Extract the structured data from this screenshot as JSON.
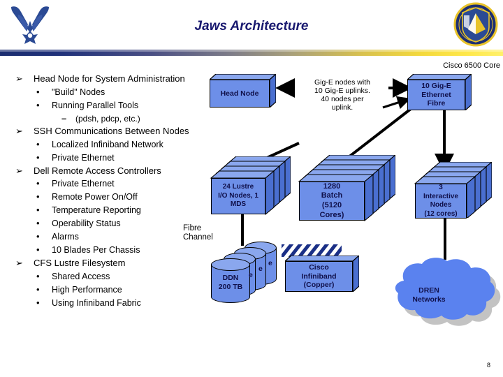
{
  "slide": {
    "title": "Jaws Architecture",
    "page_number": "8",
    "logos": {
      "left": "us-air-force-wings-logo",
      "right": "air-force-unit-shield-emblem"
    },
    "divider_colors": {
      "start": "#1b2d70",
      "middle": "#8c8a82",
      "end": "#ffe84a"
    },
    "title_color": "#1a1a70"
  },
  "bullets": [
    {
      "level": 1,
      "marker": "➢",
      "text": "Head Node for System Administration"
    },
    {
      "level": 2,
      "marker": "•",
      "text": "\"Build\" Nodes"
    },
    {
      "level": 2,
      "marker": "•",
      "text": "Running Parallel Tools"
    },
    {
      "level": 3,
      "marker": "–",
      "text": "(pdsh, pdcp, etc.)"
    },
    {
      "level": 1,
      "marker": "➢",
      "text": "SSH Communications Between Nodes"
    },
    {
      "level": 2,
      "marker": "•",
      "text": "Localized Infiniband Network"
    },
    {
      "level": 2,
      "marker": "•",
      "text": "Private Ethernet"
    },
    {
      "level": 1,
      "marker": "➢",
      "text": "Dell Remote Access Controllers"
    },
    {
      "level": 2,
      "marker": "•",
      "text": "Private Ethernet"
    },
    {
      "level": 2,
      "marker": "•",
      "text": "Remote Power On/Off"
    },
    {
      "level": 2,
      "marker": "•",
      "text": "Temperature Reporting"
    },
    {
      "level": 2,
      "marker": "•",
      "text": "Operability Status"
    },
    {
      "level": 2,
      "marker": "•",
      "text": "Alarms"
    },
    {
      "level": 2,
      "marker": "•",
      "text": "10 Blades Per Chassis"
    },
    {
      "level": 1,
      "marker": "➢",
      "text": "CFS Lustre Filesystem"
    },
    {
      "level": 2,
      "marker": "•",
      "text": "Shared Access"
    },
    {
      "level": 2,
      "marker": "•",
      "text": "High Performance"
    },
    {
      "level": 2,
      "marker": "•",
      "text": "Using Infiniband Fabric"
    }
  ],
  "diagram": {
    "node_fill_color": "#6d8fe8",
    "node_text_color": "#10104a",
    "head_node": {
      "label": "Head Node"
    },
    "cisco_core_caption": {
      "label": "Cisco 6500 Core"
    },
    "core_switch": {
      "label": "10 Gig-E\nEthernet\nFibre"
    },
    "uplink_note": {
      "label": "Gig-E nodes with\n10 Gig-E uplinks.\n40 nodes per\nuplink."
    },
    "lustre_nodes": {
      "label": "24 Lustre\nI/O Nodes, 1\nMDS"
    },
    "batch_nodes": {
      "label": "1280\nBatch\n(5120\nCores)"
    },
    "interactive_nodes": {
      "label": "3\nInteractive\nNodes\n(12 cores)"
    },
    "infiniband_switch": {
      "label": "Cisco\nInfiniband\n(Copper)"
    },
    "fibre_channel_label": {
      "label": "Fibre\nChannel"
    },
    "storage": {
      "label": "DDN\n200 TB",
      "extra_labels": [
        "e",
        "e",
        "e"
      ]
    },
    "dren_cloud": {
      "label": "DREN\nNetworks"
    }
  }
}
